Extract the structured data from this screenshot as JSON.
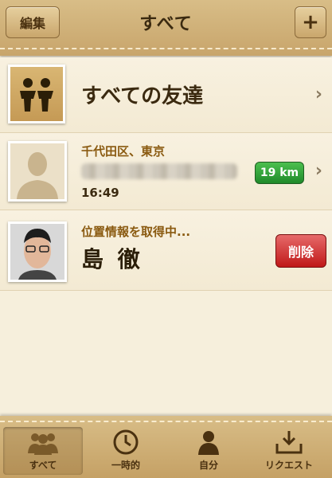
{
  "header": {
    "title": "すべて",
    "edit_label": "編集",
    "add_label": "+"
  },
  "friends": {
    "all_friends_label": "すべての友達",
    "rows": [
      {
        "location": "千代田区、東京",
        "distance": "19 km",
        "time": "16:49"
      },
      {
        "status": "位置情報を取得中...",
        "name": "島 徹",
        "delete_label": "削除"
      }
    ]
  },
  "tabs": [
    {
      "label": "すべて",
      "icon": "people-icon",
      "active": true
    },
    {
      "label": "一時的",
      "icon": "clock-icon",
      "active": false
    },
    {
      "label": "自分",
      "icon": "person-icon",
      "active": false
    },
    {
      "label": "リクエスト",
      "icon": "inbox-download-icon",
      "active": false
    }
  ],
  "colors": {
    "accent_green": "#1f8a2a",
    "delete_red": "#c01818",
    "leather": "#c8a56b"
  }
}
